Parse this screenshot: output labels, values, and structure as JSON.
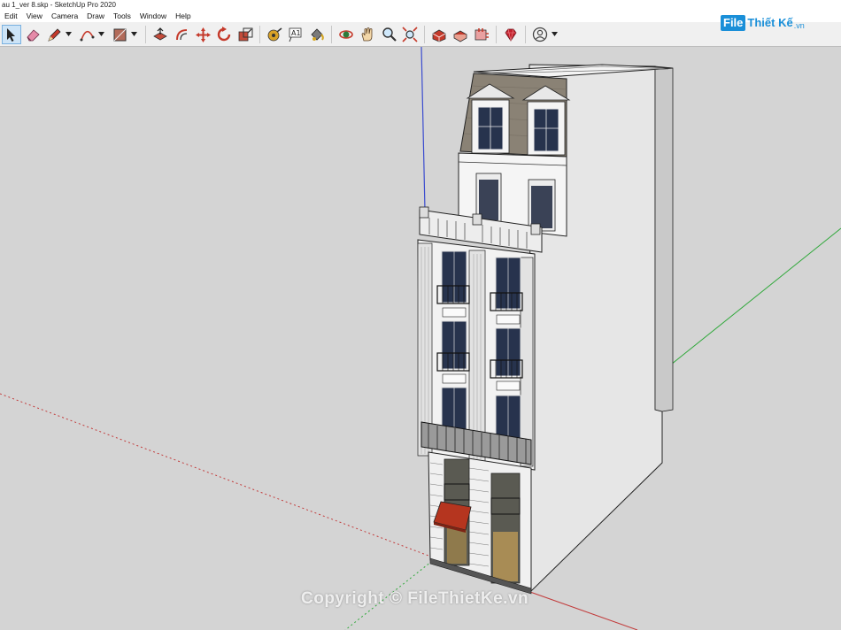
{
  "window": {
    "title": "au 1_ver 8.skp - SketchUp Pro 2020"
  },
  "menu": {
    "items": [
      "Edit",
      "View",
      "Camera",
      "Draw",
      "Tools",
      "Window",
      "Help"
    ]
  },
  "toolbar": {
    "tools": [
      {
        "name": "select-tool",
        "icon": "select-arrow-icon",
        "selected": true
      },
      {
        "name": "eraser-tool",
        "icon": "eraser-icon"
      },
      {
        "name": "line-tool",
        "icon": "pencil-icon",
        "dropdown": true
      },
      {
        "name": "arc-tool",
        "icon": "arc-icon",
        "dropdown": true
      },
      {
        "name": "rectangle-tool",
        "icon": "rectangle-icon",
        "dropdown": true
      },
      {
        "name": "push-pull-tool",
        "icon": "push-pull-icon"
      },
      {
        "name": "offset-tool",
        "icon": "offset-icon"
      },
      {
        "name": "move-tool",
        "icon": "move-icon"
      },
      {
        "name": "rotate-tool",
        "icon": "rotate-icon"
      },
      {
        "name": "scale-tool",
        "icon": "scale-icon"
      },
      {
        "name": "tape-measure-tool",
        "icon": "tape-measure-icon"
      },
      {
        "name": "text-tool",
        "icon": "text-icon"
      },
      {
        "name": "paint-bucket-tool",
        "icon": "paint-bucket-icon"
      },
      {
        "name": "orbit-tool",
        "icon": "orbit-icon"
      },
      {
        "name": "pan-tool",
        "icon": "pan-hand-icon"
      },
      {
        "name": "zoom-tool",
        "icon": "zoom-icon"
      },
      {
        "name": "zoom-extents-tool",
        "icon": "zoom-extents-icon"
      },
      {
        "name": "warehouse-tool",
        "icon": "warehouse-icon"
      },
      {
        "name": "share-model-tool",
        "icon": "share-model-icon"
      },
      {
        "name": "extension-warehouse-tool",
        "icon": "extension-warehouse-icon"
      },
      {
        "name": "ruby-tool",
        "icon": "ruby-icon"
      },
      {
        "name": "account-tool",
        "icon": "user-account-icon",
        "dropdown": true
      }
    ]
  },
  "logo": {
    "badge": "File",
    "text": "Thiết Kế",
    "tld": ".vn"
  },
  "watermark": {
    "text": "Copyright © FileThietKe.vn"
  },
  "colors": {
    "background": "#d4d4d4",
    "axis_red": "#c23b3b",
    "axis_green": "#2fa83a",
    "axis_blue": "#3b4ccf",
    "brand": "#1a8fd8",
    "roof": "#8a8275",
    "awning": "#b5351f"
  }
}
